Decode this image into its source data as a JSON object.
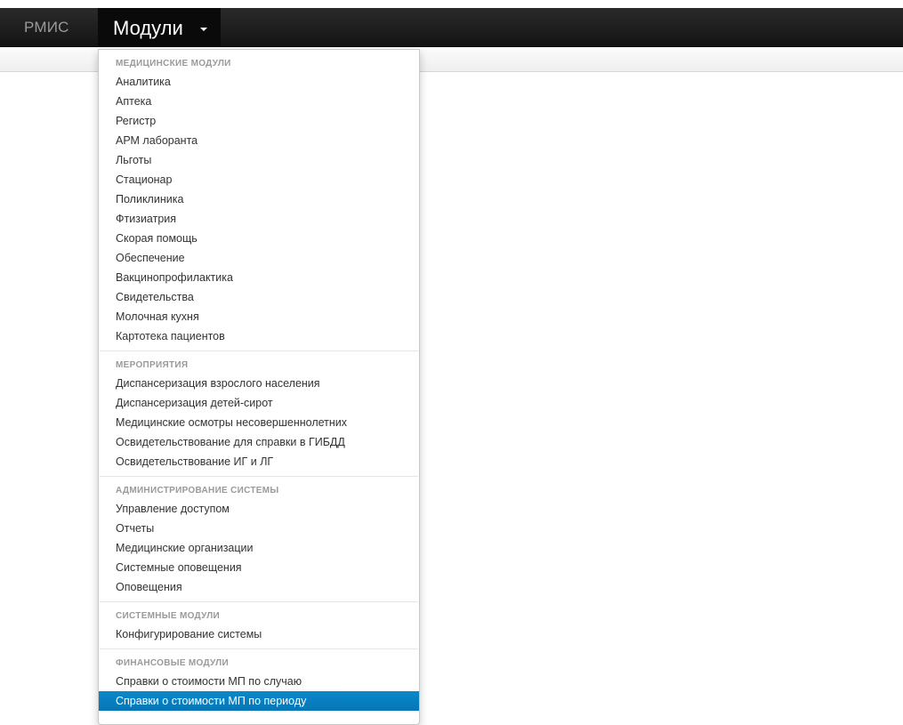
{
  "navbar": {
    "brand": "РМИС",
    "modules_label": "Модули"
  },
  "dropdown": {
    "sections": [
      {
        "header": "МЕДИЦИНСКИЕ МОДУЛИ",
        "items": [
          "Аналитика",
          "Аптека",
          "Регистр",
          "АРМ лаборанта",
          "Льготы",
          "Стационар",
          "Поликлиника",
          "Фтизиатрия",
          "Скорая помощь",
          "Обеспечение",
          "Вакцинопрофилактика",
          "Свидетельства",
          "Молочная кухня",
          "Картотека пациентов"
        ]
      },
      {
        "header": "МЕРОПРИЯТИЯ",
        "items": [
          "Диспансеризация взрослого населения",
          "Диспансеризация детей-сирот",
          "Медицинские осмотры несовершеннолетних",
          "Освидетельствование для справки в ГИБДД",
          "Освидетельствование ИГ и ЛГ"
        ]
      },
      {
        "header": "АДМИНИСТРИРОВАНИЕ СИСТЕМЫ",
        "items": [
          "Управление доступом",
          "Отчеты",
          "Медицинские организации",
          "Системные оповещения",
          "Оповещения"
        ]
      },
      {
        "header": "СИСТЕМНЫЕ МОДУЛИ",
        "items": [
          "Конфигурирование системы"
        ]
      },
      {
        "header": "ФИНАНСОВЫЕ МОДУЛИ",
        "items": [
          "Справки о стоимости МП по случаю",
          "Справки о стоимости МП по периоду"
        ]
      }
    ],
    "active_item": "Справки о стоимости МП по периоду"
  },
  "colors": {
    "navbar": "#1b1b1b",
    "brand_text": "#9a9a9a",
    "active_item_bg": "#0679b9",
    "section_header": "#9a9a9a",
    "item_text": "#333333"
  }
}
